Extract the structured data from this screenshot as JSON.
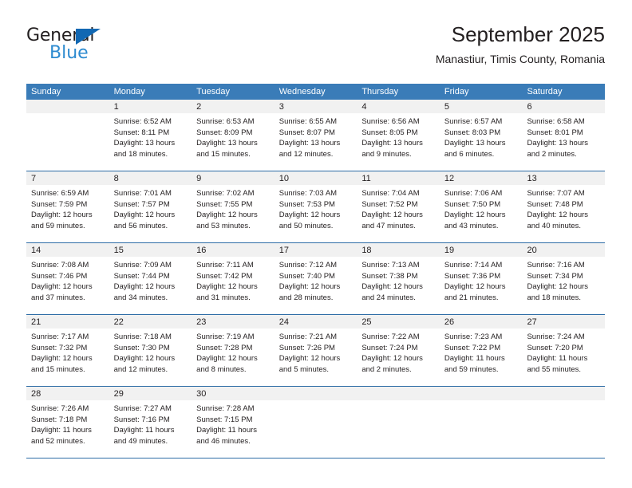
{
  "logo": {
    "word_dark": "General",
    "word_blue": "Blue",
    "triangle_color": "#1268b3",
    "blue_text_color": "#2e8bd0"
  },
  "header": {
    "title": "September 2025",
    "subtitle": "Manastiur, Timis County, Romania"
  },
  "theme": {
    "header_bg": "#3a7cb8",
    "row_separator": "#2d6ca6",
    "daynum_bg": "#f1f1f1",
    "text": "#231f20"
  },
  "calendar": {
    "weekdays": [
      "Sunday",
      "Monday",
      "Tuesday",
      "Wednesday",
      "Thursday",
      "Friday",
      "Saturday"
    ],
    "weeks": [
      {
        "days": [
          {
            "num": "",
            "lines": []
          },
          {
            "num": "1",
            "lines": [
              "Sunrise: 6:52 AM",
              "Sunset: 8:11 PM",
              "Daylight: 13 hours",
              "and 18 minutes."
            ]
          },
          {
            "num": "2",
            "lines": [
              "Sunrise: 6:53 AM",
              "Sunset: 8:09 PM",
              "Daylight: 13 hours",
              "and 15 minutes."
            ]
          },
          {
            "num": "3",
            "lines": [
              "Sunrise: 6:55 AM",
              "Sunset: 8:07 PM",
              "Daylight: 13 hours",
              "and 12 minutes."
            ]
          },
          {
            "num": "4",
            "lines": [
              "Sunrise: 6:56 AM",
              "Sunset: 8:05 PM",
              "Daylight: 13 hours",
              "and 9 minutes."
            ]
          },
          {
            "num": "5",
            "lines": [
              "Sunrise: 6:57 AM",
              "Sunset: 8:03 PM",
              "Daylight: 13 hours",
              "and 6 minutes."
            ]
          },
          {
            "num": "6",
            "lines": [
              "Sunrise: 6:58 AM",
              "Sunset: 8:01 PM",
              "Daylight: 13 hours",
              "and 2 minutes."
            ]
          }
        ]
      },
      {
        "days": [
          {
            "num": "7",
            "lines": [
              "Sunrise: 6:59 AM",
              "Sunset: 7:59 PM",
              "Daylight: 12 hours",
              "and 59 minutes."
            ]
          },
          {
            "num": "8",
            "lines": [
              "Sunrise: 7:01 AM",
              "Sunset: 7:57 PM",
              "Daylight: 12 hours",
              "and 56 minutes."
            ]
          },
          {
            "num": "9",
            "lines": [
              "Sunrise: 7:02 AM",
              "Sunset: 7:55 PM",
              "Daylight: 12 hours",
              "and 53 minutes."
            ]
          },
          {
            "num": "10",
            "lines": [
              "Sunrise: 7:03 AM",
              "Sunset: 7:53 PM",
              "Daylight: 12 hours",
              "and 50 minutes."
            ]
          },
          {
            "num": "11",
            "lines": [
              "Sunrise: 7:04 AM",
              "Sunset: 7:52 PM",
              "Daylight: 12 hours",
              "and 47 minutes."
            ]
          },
          {
            "num": "12",
            "lines": [
              "Sunrise: 7:06 AM",
              "Sunset: 7:50 PM",
              "Daylight: 12 hours",
              "and 43 minutes."
            ]
          },
          {
            "num": "13",
            "lines": [
              "Sunrise: 7:07 AM",
              "Sunset: 7:48 PM",
              "Daylight: 12 hours",
              "and 40 minutes."
            ]
          }
        ]
      },
      {
        "days": [
          {
            "num": "14",
            "lines": [
              "Sunrise: 7:08 AM",
              "Sunset: 7:46 PM",
              "Daylight: 12 hours",
              "and 37 minutes."
            ]
          },
          {
            "num": "15",
            "lines": [
              "Sunrise: 7:09 AM",
              "Sunset: 7:44 PM",
              "Daylight: 12 hours",
              "and 34 minutes."
            ]
          },
          {
            "num": "16",
            "lines": [
              "Sunrise: 7:11 AM",
              "Sunset: 7:42 PM",
              "Daylight: 12 hours",
              "and 31 minutes."
            ]
          },
          {
            "num": "17",
            "lines": [
              "Sunrise: 7:12 AM",
              "Sunset: 7:40 PM",
              "Daylight: 12 hours",
              "and 28 minutes."
            ]
          },
          {
            "num": "18",
            "lines": [
              "Sunrise: 7:13 AM",
              "Sunset: 7:38 PM",
              "Daylight: 12 hours",
              "and 24 minutes."
            ]
          },
          {
            "num": "19",
            "lines": [
              "Sunrise: 7:14 AM",
              "Sunset: 7:36 PM",
              "Daylight: 12 hours",
              "and 21 minutes."
            ]
          },
          {
            "num": "20",
            "lines": [
              "Sunrise: 7:16 AM",
              "Sunset: 7:34 PM",
              "Daylight: 12 hours",
              "and 18 minutes."
            ]
          }
        ]
      },
      {
        "days": [
          {
            "num": "21",
            "lines": [
              "Sunrise: 7:17 AM",
              "Sunset: 7:32 PM",
              "Daylight: 12 hours",
              "and 15 minutes."
            ]
          },
          {
            "num": "22",
            "lines": [
              "Sunrise: 7:18 AM",
              "Sunset: 7:30 PM",
              "Daylight: 12 hours",
              "and 12 minutes."
            ]
          },
          {
            "num": "23",
            "lines": [
              "Sunrise: 7:19 AM",
              "Sunset: 7:28 PM",
              "Daylight: 12 hours",
              "and 8 minutes."
            ]
          },
          {
            "num": "24",
            "lines": [
              "Sunrise: 7:21 AM",
              "Sunset: 7:26 PM",
              "Daylight: 12 hours",
              "and 5 minutes."
            ]
          },
          {
            "num": "25",
            "lines": [
              "Sunrise: 7:22 AM",
              "Sunset: 7:24 PM",
              "Daylight: 12 hours",
              "and 2 minutes."
            ]
          },
          {
            "num": "26",
            "lines": [
              "Sunrise: 7:23 AM",
              "Sunset: 7:22 PM",
              "Daylight: 11 hours",
              "and 59 minutes."
            ]
          },
          {
            "num": "27",
            "lines": [
              "Sunrise: 7:24 AM",
              "Sunset: 7:20 PM",
              "Daylight: 11 hours",
              "and 55 minutes."
            ]
          }
        ]
      },
      {
        "days": [
          {
            "num": "28",
            "lines": [
              "Sunrise: 7:26 AM",
              "Sunset: 7:18 PM",
              "Daylight: 11 hours",
              "and 52 minutes."
            ]
          },
          {
            "num": "29",
            "lines": [
              "Sunrise: 7:27 AM",
              "Sunset: 7:16 PM",
              "Daylight: 11 hours",
              "and 49 minutes."
            ]
          },
          {
            "num": "30",
            "lines": [
              "Sunrise: 7:28 AM",
              "Sunset: 7:15 PM",
              "Daylight: 11 hours",
              "and 46 minutes."
            ]
          },
          {
            "num": "",
            "lines": []
          },
          {
            "num": "",
            "lines": []
          },
          {
            "num": "",
            "lines": []
          },
          {
            "num": "",
            "lines": []
          }
        ]
      }
    ]
  }
}
